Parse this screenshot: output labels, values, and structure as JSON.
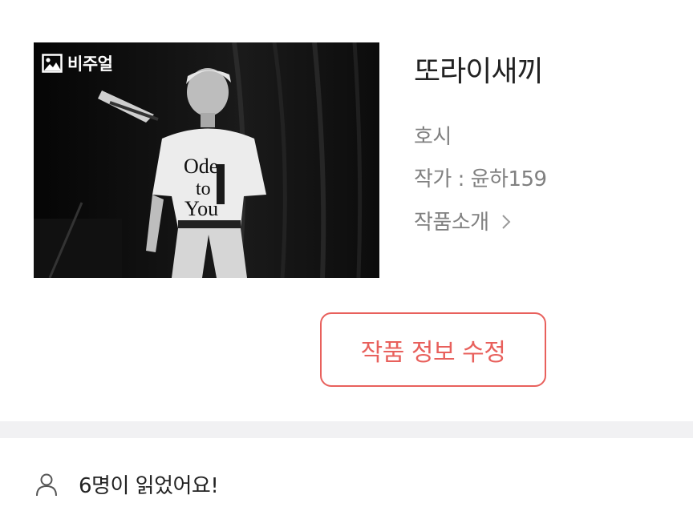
{
  "cover": {
    "badge_label": "비주얼",
    "badge_icon": "image-icon"
  },
  "work": {
    "title": "또라이새끼",
    "character": "호시",
    "author": "작가 : 윤하159",
    "intro_label": "작품소개"
  },
  "actions": {
    "edit_label": "작품 정보 수정"
  },
  "stats": {
    "readers_text": "6명이 읽었어요!"
  },
  "colors": {
    "accent": "#e8605c",
    "muted_text": "#808080",
    "divider": "#f1f1f3"
  }
}
